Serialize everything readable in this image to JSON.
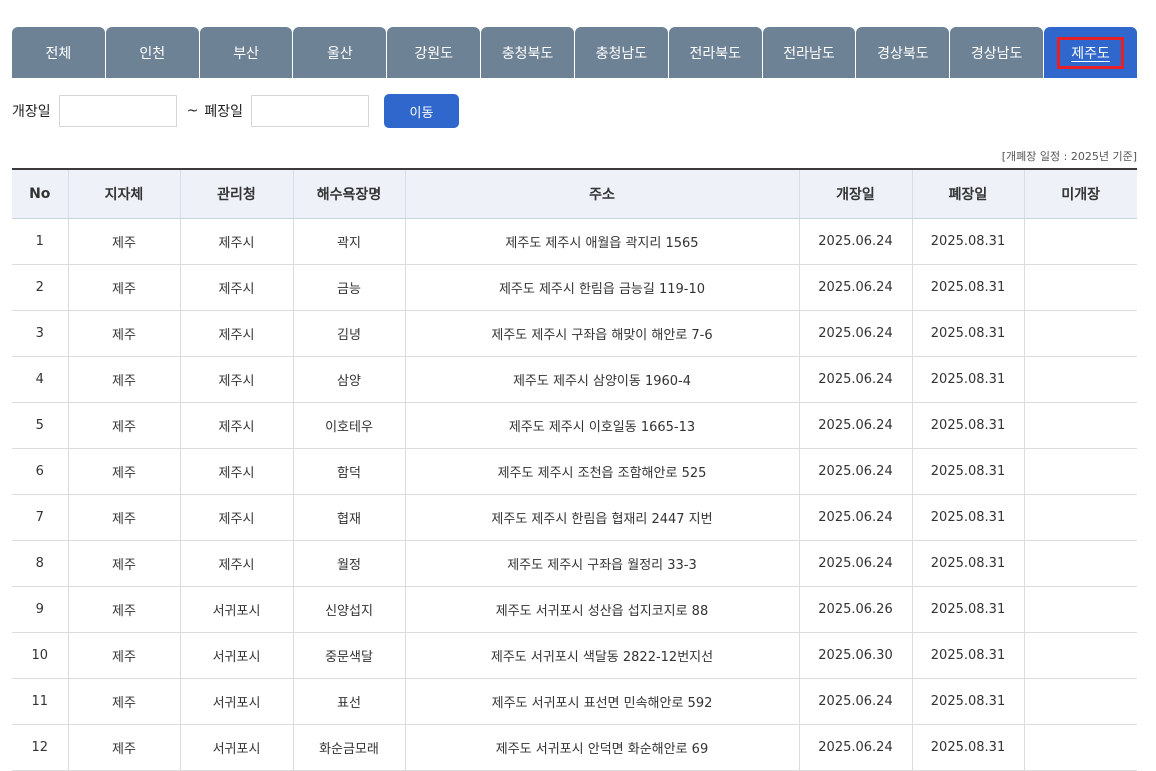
{
  "tabs": [
    {
      "label": "전체",
      "active": false
    },
    {
      "label": "인천",
      "active": false
    },
    {
      "label": "부산",
      "active": false
    },
    {
      "label": "울산",
      "active": false
    },
    {
      "label": "강원도",
      "active": false
    },
    {
      "label": "충청북도",
      "active": false
    },
    {
      "label": "충청남도",
      "active": false
    },
    {
      "label": "전라북도",
      "active": false
    },
    {
      "label": "전라남도",
      "active": false
    },
    {
      "label": "경상북도",
      "active": false
    },
    {
      "label": "경상남도",
      "active": false
    },
    {
      "label": "제주도",
      "active": true
    }
  ],
  "filter": {
    "open_label": "개장일",
    "open_value": "",
    "separator": "~",
    "close_label": "폐장일",
    "close_value": "",
    "button_label": "이동"
  },
  "note": "[개폐장 일정 : 2025년 기준]",
  "table": {
    "headers": [
      "No",
      "지자체",
      "관리청",
      "해수욕장명",
      "주소",
      "개장일",
      "폐장일",
      "미개장"
    ],
    "rows": [
      [
        "1",
        "제주",
        "제주시",
        "곽지",
        "제주도 제주시 애월읍 곽지리 1565",
        "2025.06.24",
        "2025.08.31",
        ""
      ],
      [
        "2",
        "제주",
        "제주시",
        "금능",
        "제주도 제주시 한림읍 금능길 119-10",
        "2025.06.24",
        "2025.08.31",
        ""
      ],
      [
        "3",
        "제주",
        "제주시",
        "김녕",
        "제주도 제주시 구좌읍 해맞이 해안로 7-6",
        "2025.06.24",
        "2025.08.31",
        ""
      ],
      [
        "4",
        "제주",
        "제주시",
        "삼양",
        "제주도 제주시 삼양이동 1960-4",
        "2025.06.24",
        "2025.08.31",
        ""
      ],
      [
        "5",
        "제주",
        "제주시",
        "이호테우",
        "제주도 제주시 이호일동 1665-13",
        "2025.06.24",
        "2025.08.31",
        ""
      ],
      [
        "6",
        "제주",
        "제주시",
        "함덕",
        "제주도 제주시 조천읍 조함해안로 525",
        "2025.06.24",
        "2025.08.31",
        ""
      ],
      [
        "7",
        "제주",
        "제주시",
        "협재",
        "제주도 제주시 한림읍 협재리 2447 지번",
        "2025.06.24",
        "2025.08.31",
        ""
      ],
      [
        "8",
        "제주",
        "제주시",
        "월정",
        "제주도 제주시 구좌읍 월정리 33-3",
        "2025.06.24",
        "2025.08.31",
        ""
      ],
      [
        "9",
        "제주",
        "서귀포시",
        "신양섭지",
        "제주도 서귀포시 성산읍 섭지코지로 88",
        "2025.06.26",
        "2025.08.31",
        ""
      ],
      [
        "10",
        "제주",
        "서귀포시",
        "중문색달",
        "제주도 서귀포시 색달동 2822-12번지선",
        "2025.06.30",
        "2025.08.31",
        ""
      ],
      [
        "11",
        "제주",
        "서귀포시",
        "표선",
        "제주도 서귀포시 표선면 민속해안로 592",
        "2025.06.24",
        "2025.08.31",
        ""
      ],
      [
        "12",
        "제주",
        "서귀포시",
        "화순금모래",
        "제주도 서귀포시 안덕면 화순해안로 69",
        "2025.06.24",
        "2025.08.31",
        ""
      ]
    ]
  },
  "colors": {
    "tab_bg": "#6e8296",
    "tab_active_bg": "#2f67cc",
    "highlight_border": "#e8202a",
    "button_bg": "#2f67cc",
    "header_bg": "#eef2f8"
  }
}
